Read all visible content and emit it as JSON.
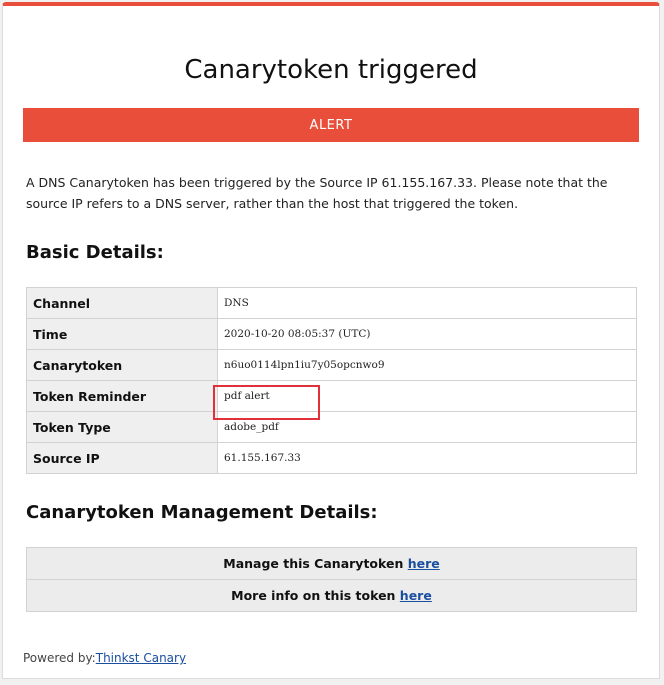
{
  "header": {
    "title": "Canarytoken triggered",
    "alert_label": "ALERT"
  },
  "description": "A DNS Canarytoken has been triggered by the Source IP 61.155.167.33. Please note that the source IP refers to a DNS server, rather than the host that triggered the token.",
  "basic_details": {
    "heading": "Basic Details:",
    "rows": [
      {
        "key": "Channel",
        "value": "DNS"
      },
      {
        "key": "Time",
        "value": "2020-10-20 08:05:37 (UTC)"
      },
      {
        "key": "Canarytoken",
        "value": "n6uo0114lpn1iu7y05opcnwo9"
      },
      {
        "key": "Token Reminder",
        "value": "pdf alert"
      },
      {
        "key": "Token Type",
        "value": "adobe_pdf"
      },
      {
        "key": "Source IP",
        "value": "61.155.167.33"
      }
    ]
  },
  "management": {
    "heading": "Canarytoken Management Details:",
    "rows": [
      {
        "text": "Manage this Canarytoken ",
        "link": "here"
      },
      {
        "text": "More info on this token ",
        "link": "here"
      }
    ]
  },
  "footer": {
    "prefix": "Powered by:",
    "link": "Thinkst Canary"
  },
  "colors": {
    "accent": "#e94e3b",
    "highlight": "#e0303a",
    "link": "#1a4fa0"
  }
}
